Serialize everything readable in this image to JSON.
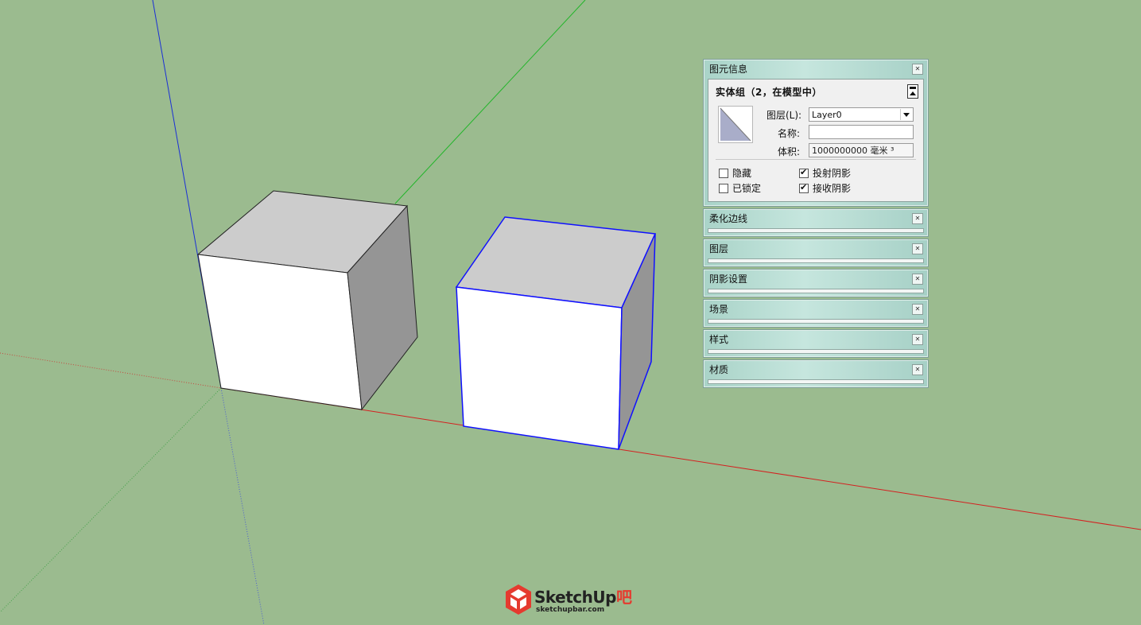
{
  "colors": {
    "background": "#9bbb8f",
    "axis_blue": "#1a2fd6",
    "axis_green": "#22b52a",
    "axis_red": "#d42020",
    "selection": "#1010ff",
    "brand_red": "#e53a2f"
  },
  "entity_info": {
    "title": "图元信息",
    "header": "实体组（2，在模型中）",
    "layer_label": "图层(L):",
    "layer_value": "Layer0",
    "name_label": "名称:",
    "name_value": "",
    "volume_label": "体积:",
    "volume_value": "1000000000 毫米 ³",
    "hide_label": "隐藏",
    "hide_checked": false,
    "locked_label": "已锁定",
    "locked_checked": false,
    "cast_shadow_label": "投射阴影",
    "cast_shadow_checked": true,
    "receive_shadow_label": "接收阴影",
    "receive_shadow_checked": true
  },
  "panels": [
    {
      "title": "柔化边线"
    },
    {
      "title": "图层"
    },
    {
      "title": "阴影设置"
    },
    {
      "title": "场景"
    },
    {
      "title": "样式"
    },
    {
      "title": "材质"
    }
  ],
  "logo": {
    "brand_main": "SketchUp",
    "brand_suffix": "吧",
    "url": "sketchupbar.com"
  }
}
